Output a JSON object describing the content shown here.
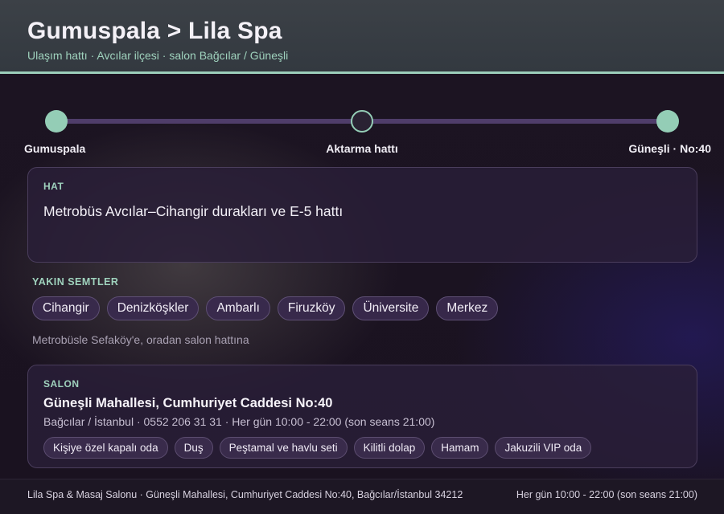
{
  "header": {
    "title": "Gumuspala > Lila Spa",
    "subtitle": "Ulaşım hattı · Avcılar ilçesi · salon Bağcılar / Güneşli"
  },
  "route": {
    "stops": [
      "Gumuspala",
      "Aktarma hattı",
      "Güneşli · No:40"
    ]
  },
  "line_card": {
    "kicker": "HAT",
    "text": "Metrobüs Avcılar–Cihangir durakları ve E-5 hattı"
  },
  "nearby": {
    "title": "YAKIN SEMTLER",
    "items": [
      "Cihangir",
      "Denizköşkler",
      "Ambarlı",
      "Firuzköy",
      "Üniversite",
      "Merkez"
    ],
    "note": "Metrobüsle Sefaköy'e, oradan salon hattına"
  },
  "salon_card": {
    "kicker": "SALON",
    "address": "Güneşli Mahallesi, Cumhuriyet Caddesi No:40",
    "details": "Bağcılar / İstanbul · 0552 206 31 31 · Her gün 10:00 - 22:00 (son seans 21:00)",
    "amenities": [
      "Kişiye özel kapalı oda",
      "Duş",
      "Peştamal ve havlu seti",
      "Kilitli dolap",
      "Hamam",
      "Jakuzili VIP oda"
    ]
  },
  "footer": {
    "left": "Lila Spa & Masaj Salonu · Güneşli Mahallesi, Cumhuriyet Caddesi No:40, Bağcılar/İstanbul 34212",
    "right": "Her gün 10:00 - 22:00 (son seans 21:00)"
  },
  "colors": {
    "accent": "#9fd2bd",
    "track": "#4f3d6a",
    "card_bg": "#2a1e38"
  }
}
